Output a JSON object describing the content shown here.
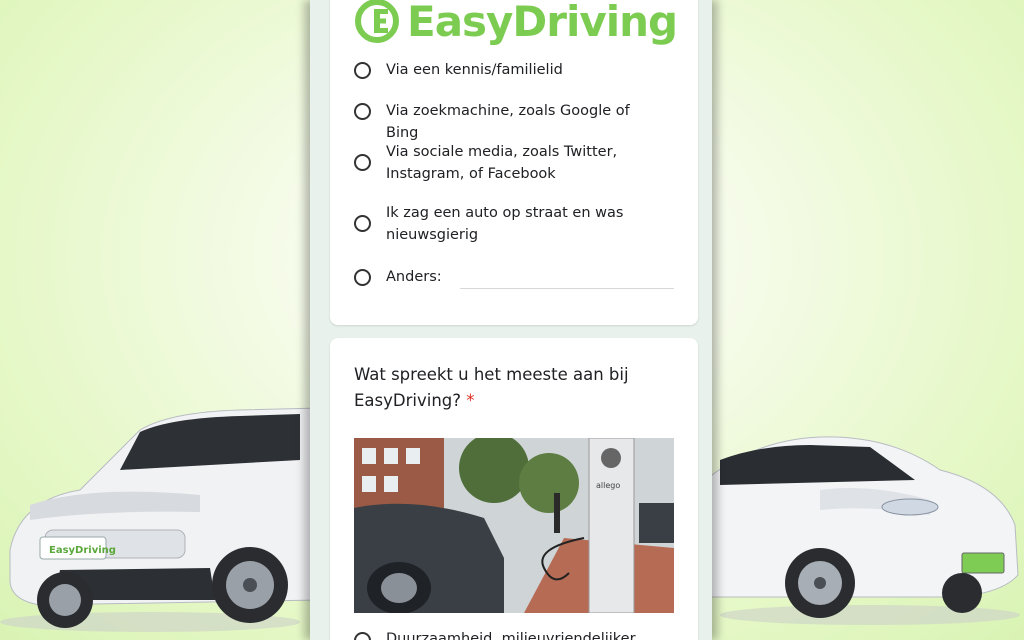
{
  "brand": {
    "name": "EasyDriving",
    "accent": "#7dcc52",
    "plate_text": "EasyDriving"
  },
  "card1": {
    "options": [
      "Via een kennis/familielid",
      "Via zoekmachine, zoals Google of Bing",
      "Via sociale media, zoals Twitter, Instagram, of Facebook",
      "Ik zag een auto op straat en was nieuwsgierig",
      "Anders:"
    ]
  },
  "card2": {
    "question": "Wat spreekt u het meeste aan bij EasyDriving?",
    "required_mark": "*",
    "charger_brand": "allego",
    "partial_option": "Duurzaamheid, milieuvriendelijker"
  }
}
